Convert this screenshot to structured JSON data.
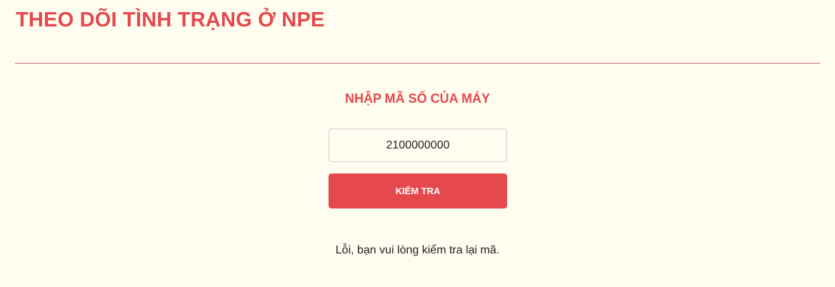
{
  "header": {
    "title": "THEO DÕI TÌNH TRẠNG Ở NPE"
  },
  "form": {
    "heading": "NHẬP MÃ SỐ CỦA MÁY",
    "code_value": "2100000000",
    "submit_label": "KIỂM TRA"
  },
  "result": {
    "error_message": "Lỗi, bạn vui lòng kiểm tra lại mã."
  },
  "colors": {
    "accent": "#e5484d",
    "background": "#fffdf0",
    "divider": "#d46a6a"
  }
}
